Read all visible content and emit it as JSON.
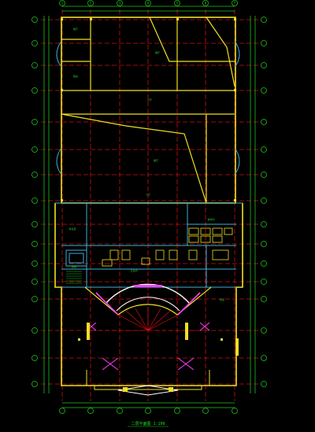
{
  "colors": {
    "background": "#000000",
    "axis_grid": "#e01010",
    "walls": "#f0e020",
    "partitions": "#3ab0d8",
    "dimension": "#20c020",
    "text": "#20e020",
    "arc": "#ffffff",
    "accent": "#ff40ff"
  },
  "drawing": {
    "caption": "二层平面图 1:100",
    "column_axes_top": [
      "1",
      "2",
      "3",
      "4",
      "5",
      "6",
      "7",
      "8",
      "9"
    ],
    "row_axes_side": [
      "A",
      "B",
      "C",
      "D",
      "E",
      "F",
      "G",
      "H",
      "J",
      "K",
      "L",
      "M",
      "N",
      "P",
      "Q",
      "R",
      "S",
      "T"
    ],
    "room_labels": [
      "餐厅",
      "餐厅",
      "厨房",
      "餐厅",
      "操作间",
      "大厅",
      "休息室",
      "包间",
      "卫生间",
      "楼梯",
      "入口"
    ]
  }
}
